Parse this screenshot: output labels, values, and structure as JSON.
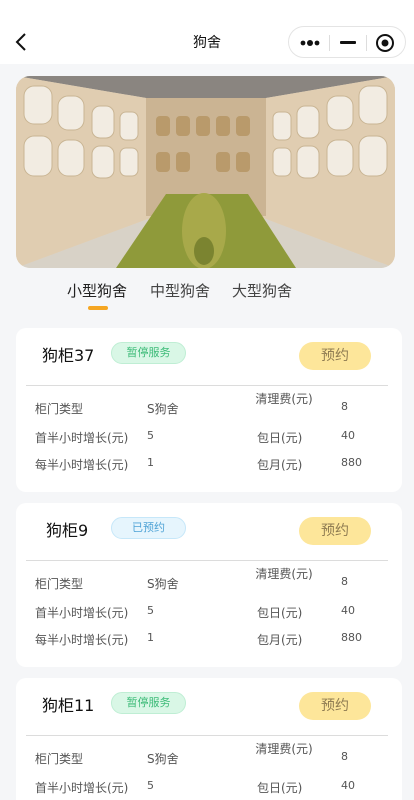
{
  "nav": {
    "title": "狗舍"
  },
  "tabs": [
    {
      "label": "小型狗舍"
    },
    {
      "label": "中型狗舍"
    },
    {
      "label": "大型狗舍"
    }
  ],
  "cards": [
    {
      "name": "狗柜37",
      "status": "暂停服务",
      "book_label": "预约",
      "rows": [
        {
          "label1": "柜门类型",
          "value1": "S狗舍",
          "label2": "清理费(元)",
          "value2": "8"
        },
        {
          "label1": "首半小时增长(元)",
          "value1": "5",
          "label2": "包日(元)",
          "value2": "40"
        },
        {
          "label1": "每半小时增长(元)",
          "value1": "1",
          "label2": "包月(元)",
          "value2": "880"
        }
      ]
    },
    {
      "name": "狗柜9",
      "status": "已预约",
      "book_label": "预约",
      "rows": [
        {
          "label1": "柜门类型",
          "value1": "S狗舍",
          "label2": "清理费(元)",
          "value2": "8"
        },
        {
          "label1": "首半小时增长(元)",
          "value1": "5",
          "label2": "包日(元)",
          "value2": "40"
        },
        {
          "label1": "每半小时增长(元)",
          "value1": "1",
          "label2": "包月(元)",
          "value2": "880"
        }
      ]
    },
    {
      "name": "狗柜11",
      "status": "暂停服务",
      "book_label": "预约",
      "rows": [
        {
          "label1": "柜门类型",
          "value1": "S狗舍",
          "label2": "清理费(元)",
          "value2": "8"
        },
        {
          "label1": "首半小时增长(元)",
          "value1": "5",
          "label2": "包日(元)",
          "value2": "40"
        }
      ]
    }
  ],
  "colors": {
    "accent": "#f5a623",
    "book_button": "#fde69a",
    "paused_badge": "#d9f7e6",
    "reserved_badge": "#e6f5fd"
  }
}
